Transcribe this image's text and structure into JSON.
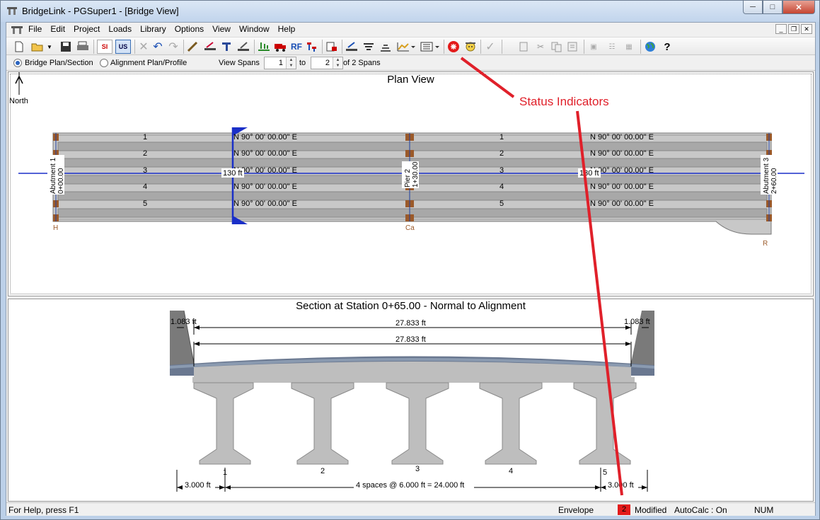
{
  "window": {
    "title": "BridgeLink - PGSuper1 - [Bridge View]"
  },
  "menu": [
    "File",
    "Edit",
    "Project",
    "Loads",
    "Library",
    "Options",
    "View",
    "Window",
    "Help"
  ],
  "toolbar": {
    "icons": [
      "new-icon",
      "open-icon",
      "dropdown-icon",
      "save-icon",
      "print-icon",
      "si-units-icon",
      "us-units-icon",
      "delete-icon",
      "undo-icon",
      "redo-icon",
      "edit-girder-icon",
      "edit-span-icon",
      "edit-pier-icon",
      "edit-deck-icon",
      "loads-icon",
      "truck-icon",
      "rf-icon",
      "analysis-icon",
      "report-icon",
      "graph-icon",
      "spec-icon",
      "criteria-icon",
      "chart-icon",
      "menu-report-icon",
      "status-error-icon",
      "status-info-icon",
      "lightning-icon",
      "copy-icon",
      "cut-icon",
      "paste-icon",
      "properties-icon",
      "align-icon",
      "align2-icon",
      "grid-icon",
      "globe-icon",
      "help-icon"
    ],
    "si_label": "SI",
    "us_label": "US",
    "rf_label": "RF"
  },
  "viewbar": {
    "option1": "Bridge Plan/Section",
    "option2": "Alignment Plan/Profile",
    "view_spans_label": "View Spans",
    "from": "1",
    "to_label": "to",
    "to": "2",
    "of_label": "of 2 Spans"
  },
  "plan": {
    "title": "Plan View",
    "north": "North",
    "girders": [
      "1",
      "2",
      "3",
      "4",
      "5"
    ],
    "bearing": "N 90° 00' 00.00\" E",
    "span_length": "130 ft",
    "abutment1": "Abutment 1",
    "abutment1_station": "0+00.00",
    "pier2": "Pier 2",
    "pier2_station": "1+30.00",
    "abutment3": "Abutment 3",
    "abutment3_station": "2+60.00",
    "marker_h": "H",
    "marker_ca": "Ca",
    "marker_r": "R"
  },
  "section": {
    "title": "Section at Station 0+65.00 - Normal to Alignment",
    "left_overhang_top": "1.083 ft",
    "right_overhang_top": "1.083 ft",
    "width1": "27.833 ft",
    "width2": "27.833 ft",
    "left_dim": "3.000 ft",
    "spacing": "4 spaces @ 6.000 ft = 24.000 ft",
    "right_dim": "3.000 ft",
    "girders": [
      "1",
      "2",
      "3",
      "4",
      "5"
    ]
  },
  "annotation": {
    "label": "Status Indicators",
    "color": "#e0202a"
  },
  "statusbar": {
    "help": "For Help, press F1",
    "envelope": "Envelope",
    "count": "2",
    "modified": "Modified",
    "autocalc": "AutoCalc : On",
    "num": "NUM"
  }
}
